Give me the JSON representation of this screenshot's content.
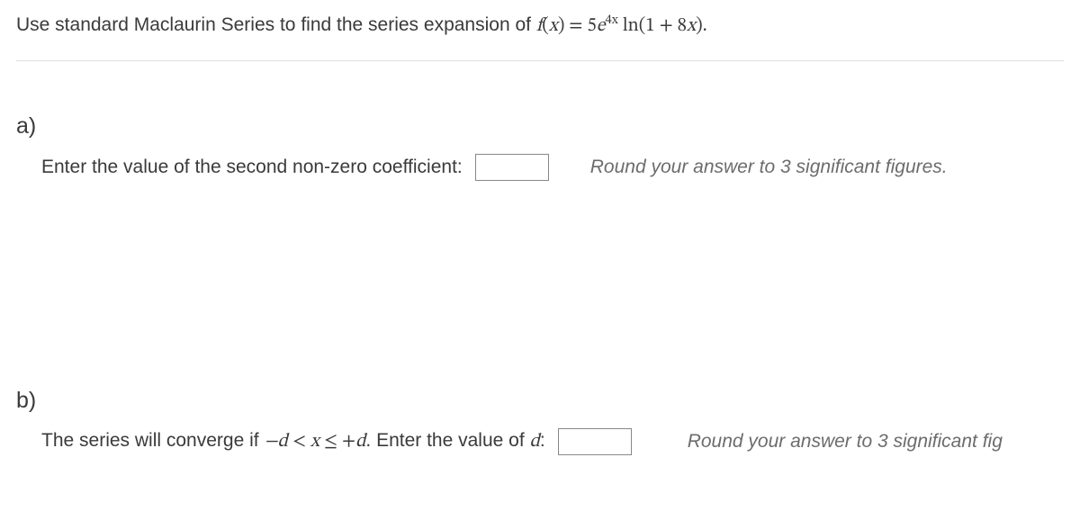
{
  "intro": {
    "prefix": "Use standard Maclaurin Series to find the series expansion of ",
    "math_f": "f",
    "math_open": "(",
    "math_x": "x",
    "math_close": ") = 5",
    "math_e": "e",
    "math_exp": "4x",
    "math_ln": " ln(1 + 8",
    "math_x2": "x",
    "math_end": ")."
  },
  "partA": {
    "label": "a)",
    "text": "Enter the value of the second non-zero coefficient: ",
    "hint": "Round your answer to 3 significant figures."
  },
  "partB": {
    "label": "b)",
    "text_prefix": "The series will converge if ",
    "math_neg_d": "−d",
    "math_lt": " < ",
    "math_x": "x",
    "math_le": " ≤ +",
    "math_d": "d",
    "text_suffix": ". Enter the value of ",
    "math_d2": "d",
    "text_colon": ": ",
    "hint": "Round your answer to 3 significant fig"
  }
}
